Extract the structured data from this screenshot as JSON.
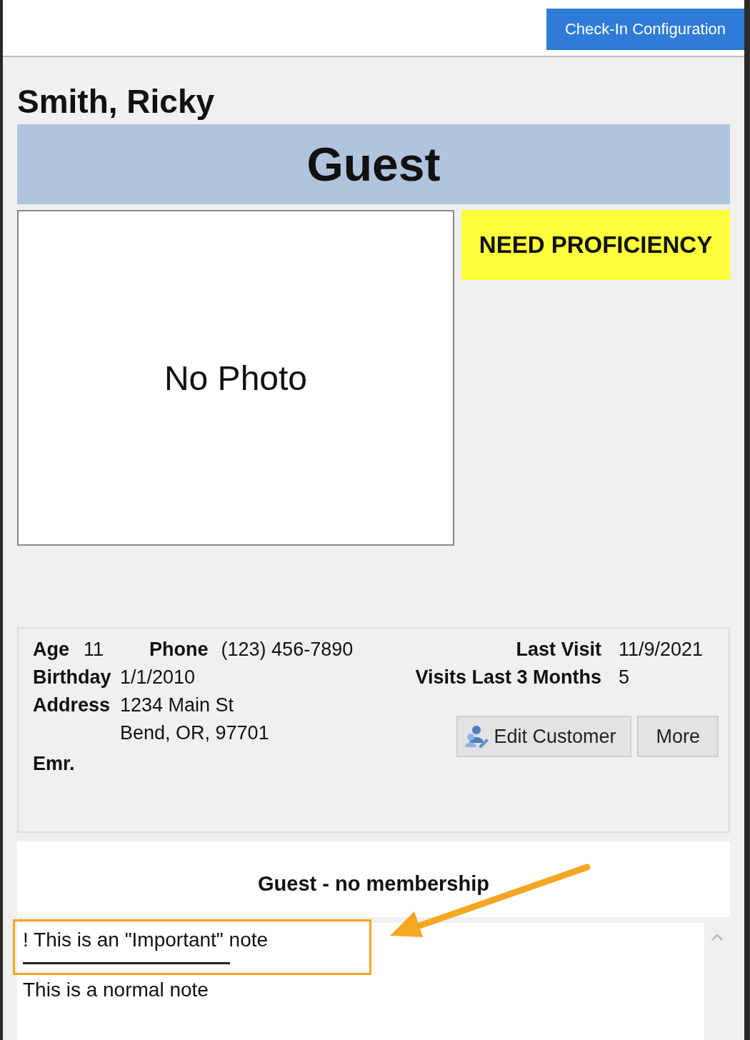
{
  "header": {
    "config_button": "Check-In Configuration"
  },
  "customer": {
    "name": "Smith, Ricky",
    "status": "Guest",
    "badge": "NEED PROFICIENCY",
    "photo_placeholder": "No Photo"
  },
  "details": {
    "age_label": "Age",
    "age": "11",
    "phone_label": "Phone",
    "phone": "(123) 456-7890",
    "birthday_label": "Birthday",
    "birthday": "1/1/2010",
    "address_label": "Address",
    "address_lines": [
      "1234 Main St",
      "Bend, OR, 97701"
    ],
    "emr_label": "Emr.",
    "last_visit_label": "Last Visit",
    "last_visit": "11/9/2021",
    "visits_label": "Visits Last 3 Months",
    "visits": "5"
  },
  "buttons": [
    {
      "label": "Edit Customer",
      "kind": "edit"
    },
    {
      "label": "More",
      "kind": "plain"
    }
  ],
  "membership": "Guest - no membership",
  "notes": [
    {
      "text": "! This is an \"Important\" note",
      "kind": "important"
    },
    {
      "text": "This is a normal note",
      "kind": "normal"
    }
  ]
}
